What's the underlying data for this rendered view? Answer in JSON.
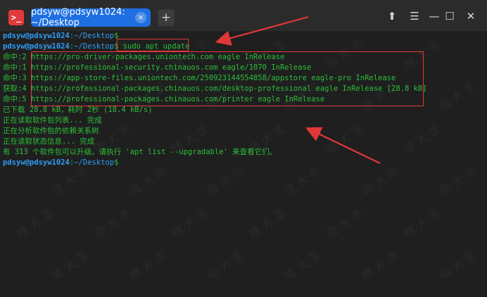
{
  "window": {
    "app_icon_glyph": ">_",
    "tab_title": "pdsyw@pdsyw1024: ~/Desktop",
    "tab_close_glyph": "×",
    "new_tab_glyph": "+",
    "pin_glyph": "⬆",
    "menu_glyph": "☰",
    "minimize_glyph": "—",
    "maximize_glyph": "☐",
    "close_glyph": "✕"
  },
  "watermark": "晓 大 圣",
  "terminal": {
    "prompt_user": "pdsyw@pdsyw1024",
    "prompt_sep": ":",
    "prompt_path": "~/Desktop",
    "prompt_dollar": "$",
    "command": " sudo apt update",
    "lines": [
      "命中:2 https://pro-driver-packages.uniontech.com eagle InRelease",
      "命中:1 https://professional-security.chinauos.com eagle/1070 InRelease",
      "命中:3 https://app-store-files.uniontech.com/250923144554858/appstore eagle-pro InRelease",
      "获取:4 https://professional-packages.chinauos.com/desktop-professional eagle InRelease [28.8 kB]",
      "命中:5 https://professional-packages.chinauos.com/printer eagle InRelease",
      "已下载 28.8 kB，耗时 2秒 (18.4 kB/s)",
      "正在读取软件包列表... 完成",
      "正在分析软件包的依赖关系树",
      "正在读取状态信息... 完成",
      "有 313 个软件包可以升级。请执行 'apt list --upgradable' 来查看它们。"
    ]
  },
  "colors": {
    "prompt_user": "#2f9cf5",
    "output_text": "#2bbf39",
    "annotation": "#e03838",
    "tab_active": "#1d6fe2"
  }
}
